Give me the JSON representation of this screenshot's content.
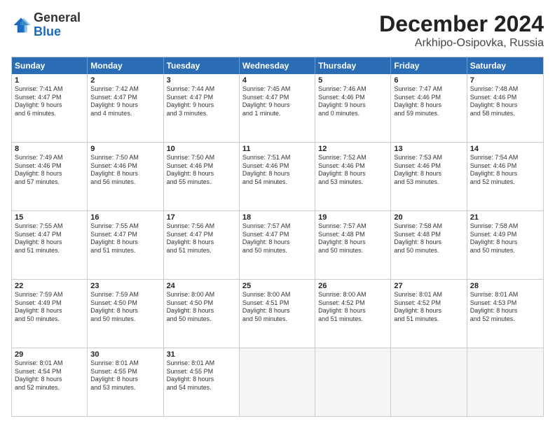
{
  "header": {
    "logo_general": "General",
    "logo_blue": "Blue",
    "month_year": "December 2024",
    "location": "Arkhipo-Osipovka, Russia"
  },
  "days_of_week": [
    "Sunday",
    "Monday",
    "Tuesday",
    "Wednesday",
    "Thursday",
    "Friday",
    "Saturday"
  ],
  "weeks": [
    [
      {
        "day": "1",
        "lines": [
          "Sunrise: 7:41 AM",
          "Sunset: 4:47 PM",
          "Daylight: 9 hours",
          "and 6 minutes."
        ]
      },
      {
        "day": "2",
        "lines": [
          "Sunrise: 7:42 AM",
          "Sunset: 4:47 PM",
          "Daylight: 9 hours",
          "and 4 minutes."
        ]
      },
      {
        "day": "3",
        "lines": [
          "Sunrise: 7:44 AM",
          "Sunset: 4:47 PM",
          "Daylight: 9 hours",
          "and 3 minutes."
        ]
      },
      {
        "day": "4",
        "lines": [
          "Sunrise: 7:45 AM",
          "Sunset: 4:47 PM",
          "Daylight: 9 hours",
          "and 1 minute."
        ]
      },
      {
        "day": "5",
        "lines": [
          "Sunrise: 7:46 AM",
          "Sunset: 4:46 PM",
          "Daylight: 9 hours",
          "and 0 minutes."
        ]
      },
      {
        "day": "6",
        "lines": [
          "Sunrise: 7:47 AM",
          "Sunset: 4:46 PM",
          "Daylight: 8 hours",
          "and 59 minutes."
        ]
      },
      {
        "day": "7",
        "lines": [
          "Sunrise: 7:48 AM",
          "Sunset: 4:46 PM",
          "Daylight: 8 hours",
          "and 58 minutes."
        ]
      }
    ],
    [
      {
        "day": "8",
        "lines": [
          "Sunrise: 7:49 AM",
          "Sunset: 4:46 PM",
          "Daylight: 8 hours",
          "and 57 minutes."
        ]
      },
      {
        "day": "9",
        "lines": [
          "Sunrise: 7:50 AM",
          "Sunset: 4:46 PM",
          "Daylight: 8 hours",
          "and 56 minutes."
        ]
      },
      {
        "day": "10",
        "lines": [
          "Sunrise: 7:50 AM",
          "Sunset: 4:46 PM",
          "Daylight: 8 hours",
          "and 55 minutes."
        ]
      },
      {
        "day": "11",
        "lines": [
          "Sunrise: 7:51 AM",
          "Sunset: 4:46 PM",
          "Daylight: 8 hours",
          "and 54 minutes."
        ]
      },
      {
        "day": "12",
        "lines": [
          "Sunrise: 7:52 AM",
          "Sunset: 4:46 PM",
          "Daylight: 8 hours",
          "and 53 minutes."
        ]
      },
      {
        "day": "13",
        "lines": [
          "Sunrise: 7:53 AM",
          "Sunset: 4:46 PM",
          "Daylight: 8 hours",
          "and 53 minutes."
        ]
      },
      {
        "day": "14",
        "lines": [
          "Sunrise: 7:54 AM",
          "Sunset: 4:46 PM",
          "Daylight: 8 hours",
          "and 52 minutes."
        ]
      }
    ],
    [
      {
        "day": "15",
        "lines": [
          "Sunrise: 7:55 AM",
          "Sunset: 4:47 PM",
          "Daylight: 8 hours",
          "and 51 minutes."
        ]
      },
      {
        "day": "16",
        "lines": [
          "Sunrise: 7:55 AM",
          "Sunset: 4:47 PM",
          "Daylight: 8 hours",
          "and 51 minutes."
        ]
      },
      {
        "day": "17",
        "lines": [
          "Sunrise: 7:56 AM",
          "Sunset: 4:47 PM",
          "Daylight: 8 hours",
          "and 51 minutes."
        ]
      },
      {
        "day": "18",
        "lines": [
          "Sunrise: 7:57 AM",
          "Sunset: 4:47 PM",
          "Daylight: 8 hours",
          "and 50 minutes."
        ]
      },
      {
        "day": "19",
        "lines": [
          "Sunrise: 7:57 AM",
          "Sunset: 4:48 PM",
          "Daylight: 8 hours",
          "and 50 minutes."
        ]
      },
      {
        "day": "20",
        "lines": [
          "Sunrise: 7:58 AM",
          "Sunset: 4:48 PM",
          "Daylight: 8 hours",
          "and 50 minutes."
        ]
      },
      {
        "day": "21",
        "lines": [
          "Sunrise: 7:58 AM",
          "Sunset: 4:49 PM",
          "Daylight: 8 hours",
          "and 50 minutes."
        ]
      }
    ],
    [
      {
        "day": "22",
        "lines": [
          "Sunrise: 7:59 AM",
          "Sunset: 4:49 PM",
          "Daylight: 8 hours",
          "and 50 minutes."
        ]
      },
      {
        "day": "23",
        "lines": [
          "Sunrise: 7:59 AM",
          "Sunset: 4:50 PM",
          "Daylight: 8 hours",
          "and 50 minutes."
        ]
      },
      {
        "day": "24",
        "lines": [
          "Sunrise: 8:00 AM",
          "Sunset: 4:50 PM",
          "Daylight: 8 hours",
          "and 50 minutes."
        ]
      },
      {
        "day": "25",
        "lines": [
          "Sunrise: 8:00 AM",
          "Sunset: 4:51 PM",
          "Daylight: 8 hours",
          "and 50 minutes."
        ]
      },
      {
        "day": "26",
        "lines": [
          "Sunrise: 8:00 AM",
          "Sunset: 4:52 PM",
          "Daylight: 8 hours",
          "and 51 minutes."
        ]
      },
      {
        "day": "27",
        "lines": [
          "Sunrise: 8:01 AM",
          "Sunset: 4:52 PM",
          "Daylight: 8 hours",
          "and 51 minutes."
        ]
      },
      {
        "day": "28",
        "lines": [
          "Sunrise: 8:01 AM",
          "Sunset: 4:53 PM",
          "Daylight: 8 hours",
          "and 52 minutes."
        ]
      }
    ],
    [
      {
        "day": "29",
        "lines": [
          "Sunrise: 8:01 AM",
          "Sunset: 4:54 PM",
          "Daylight: 8 hours",
          "and 52 minutes."
        ]
      },
      {
        "day": "30",
        "lines": [
          "Sunrise: 8:01 AM",
          "Sunset: 4:55 PM",
          "Daylight: 8 hours",
          "and 53 minutes."
        ]
      },
      {
        "day": "31",
        "lines": [
          "Sunrise: 8:01 AM",
          "Sunset: 4:55 PM",
          "Daylight: 8 hours",
          "and 54 minutes."
        ]
      },
      {
        "day": "",
        "lines": []
      },
      {
        "day": "",
        "lines": []
      },
      {
        "day": "",
        "lines": []
      },
      {
        "day": "",
        "lines": []
      }
    ]
  ]
}
